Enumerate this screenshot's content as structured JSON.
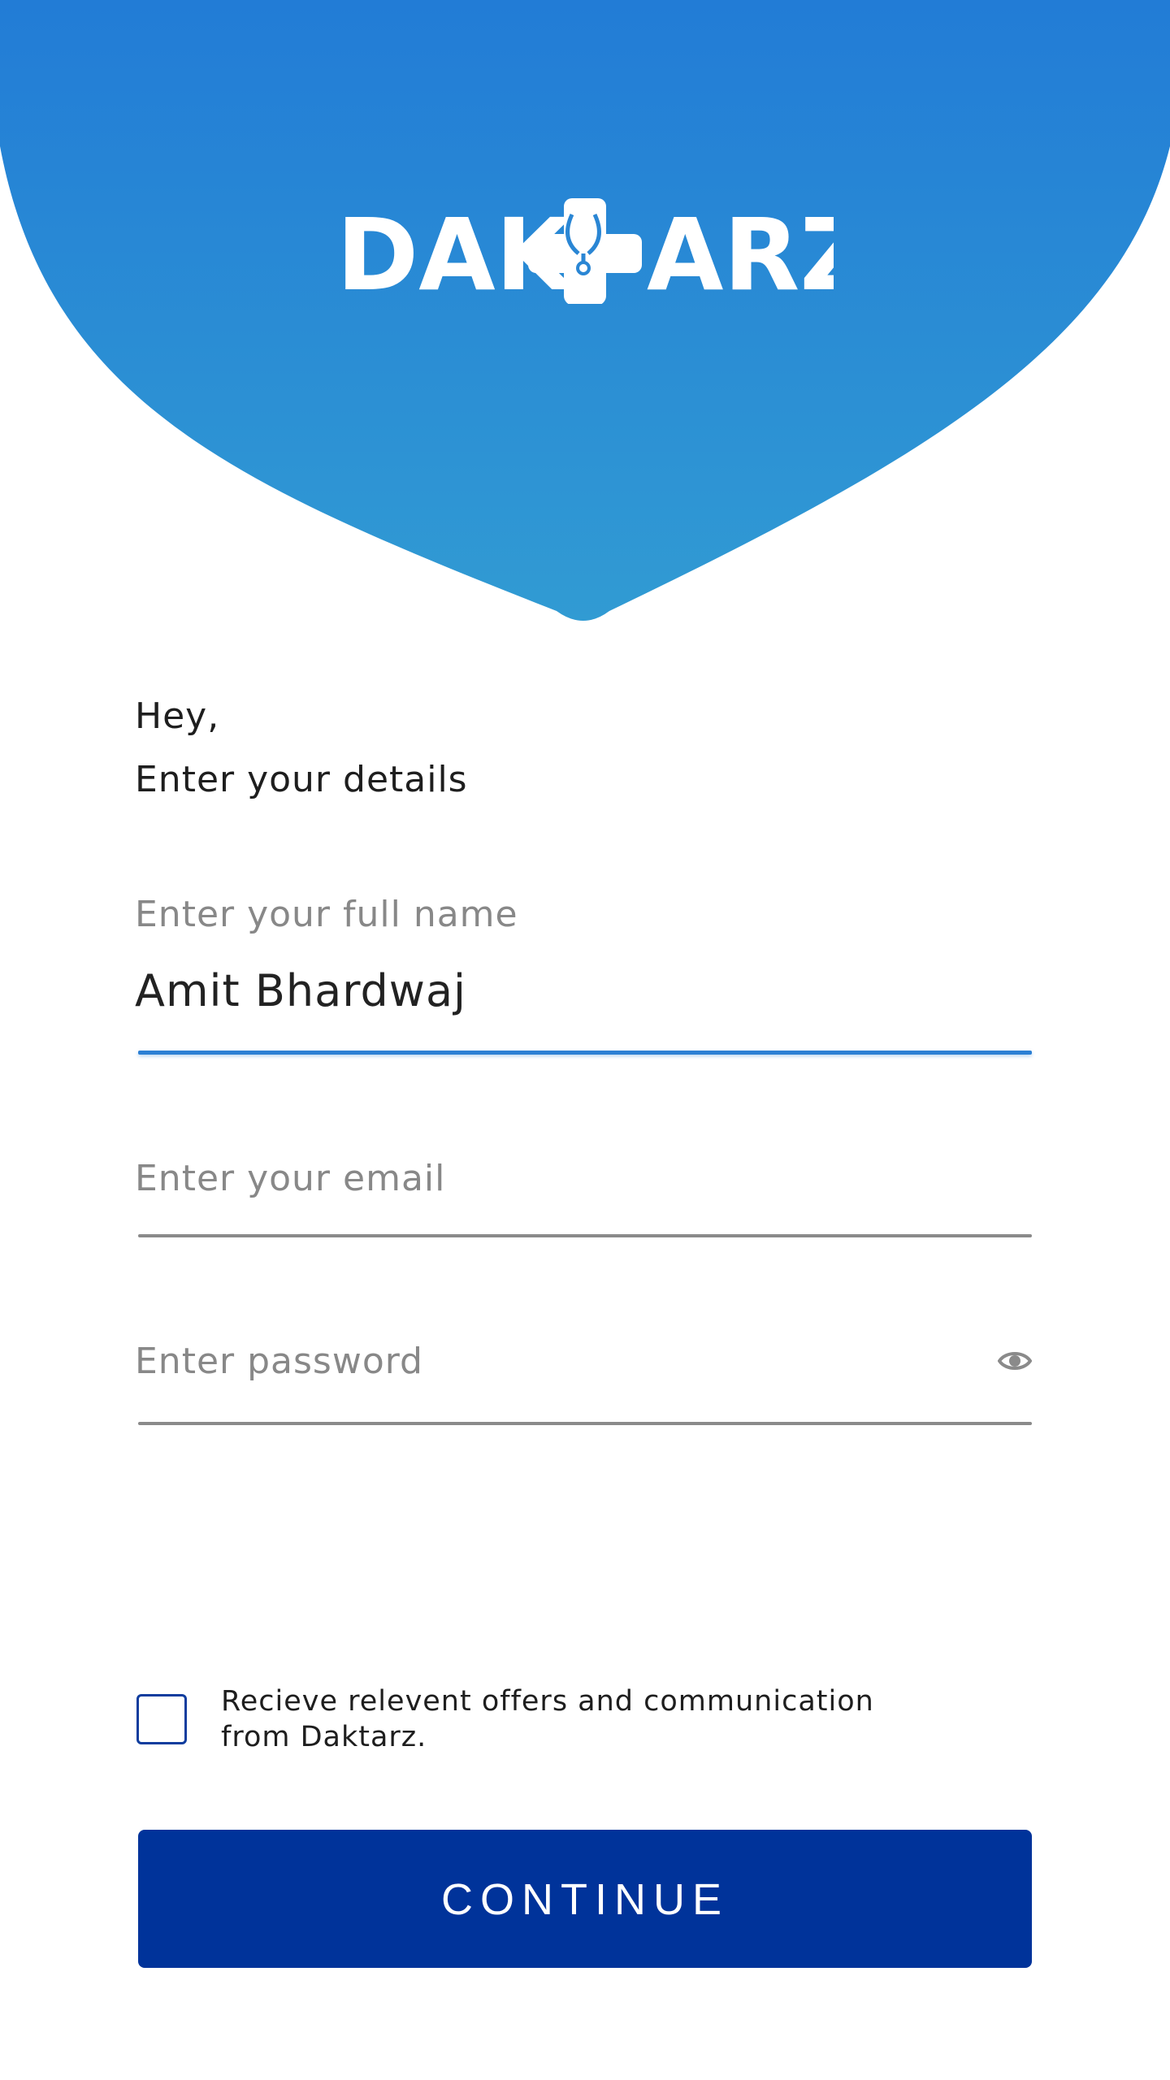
{
  "brand": {
    "name": "DAKTARZ",
    "logo_left": "DAK",
    "logo_right": "ARZ",
    "gradient_top": "#227cd6",
    "gradient_bottom": "#319bd3"
  },
  "greeting": {
    "line1": "Hey,",
    "line2": "Enter your details"
  },
  "form": {
    "full_name": {
      "label": "Enter your full name",
      "value": "Amit Bhardwaj",
      "accent_color": "#2b7fd4"
    },
    "email": {
      "placeholder": "Enter your email",
      "value": ""
    },
    "password": {
      "placeholder": "Enter password",
      "value": "",
      "toggle_icon": "eye-icon"
    }
  },
  "consent": {
    "label": "Recieve relevent offers and communication from Daktarz.",
    "checked": false
  },
  "actions": {
    "continue_label": "CONTINUE",
    "continue_color": "#00339a"
  }
}
